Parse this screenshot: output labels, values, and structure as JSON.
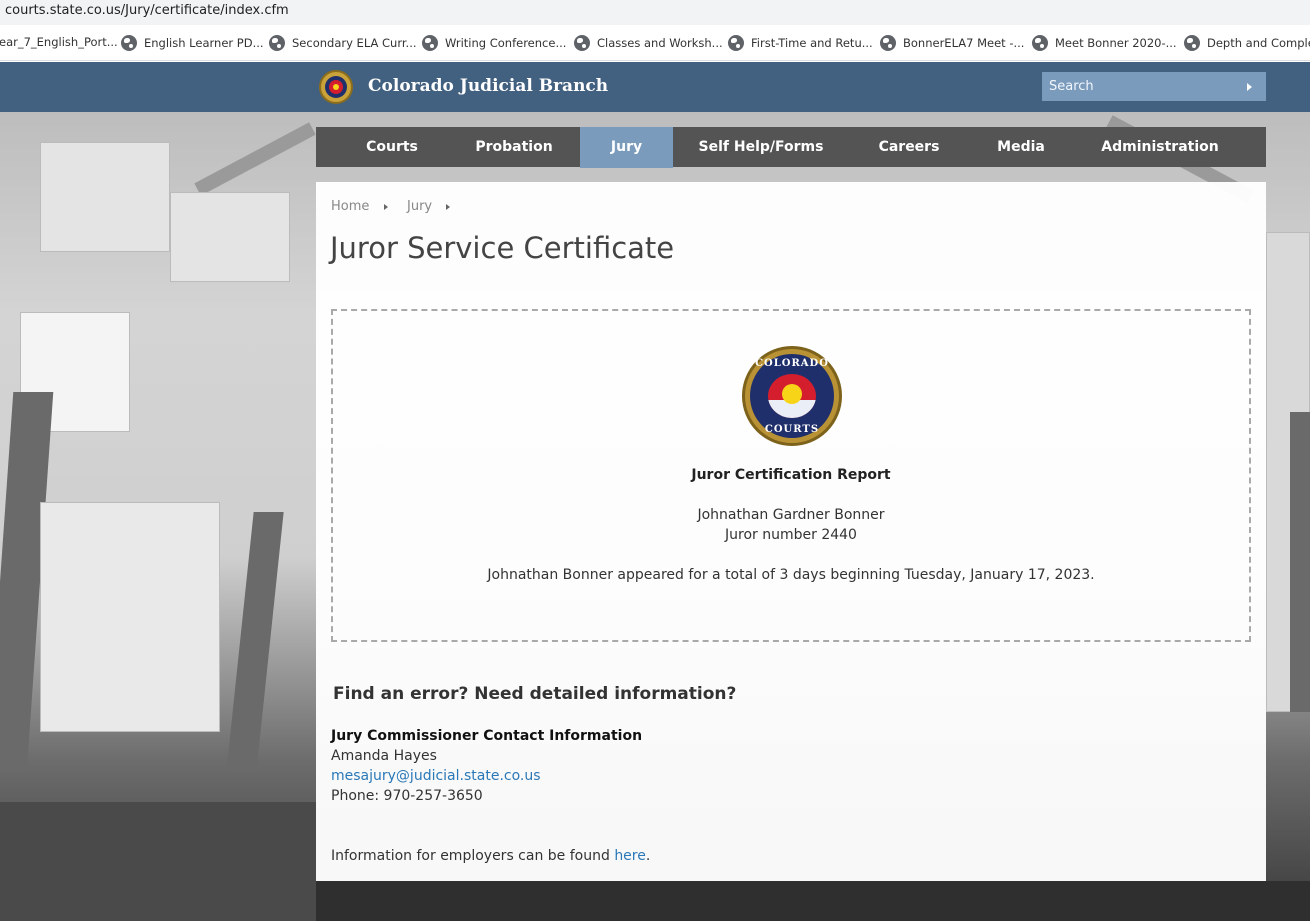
{
  "browser": {
    "url": "courts.state.co.us/Jury/certificate/index.cfm",
    "bookmarks": [
      "ear_7_English_Port...",
      "English Learner PD...",
      "Secondary ELA Curr...",
      "Writing Conference...",
      "Classes and Worksh...",
      "First-Time and Retu...",
      "BonnerELA7 Meet -...",
      "Meet Bonner 2020-...",
      "Depth and Comple..."
    ]
  },
  "header": {
    "site_title": "Colorado Judicial Branch",
    "search_placeholder": "Search"
  },
  "nav": {
    "items": [
      "Courts",
      "Probation",
      "Jury",
      "Self Help/Forms",
      "Careers",
      "Media",
      "Administration"
    ],
    "active": "Jury"
  },
  "breadcrumb": [
    "Home",
    "Jury"
  ],
  "page_title": "Juror Service Certificate",
  "certificate": {
    "seal_top_text": "COLORADO",
    "seal_bottom_text": "COURTS",
    "heading": "Juror Certification Report",
    "juror_name": "Johnathan Gardner Bonner",
    "juror_number": "Juror number 2440",
    "summary": "Johnathan Bonner appeared for a total of 3 days beginning Tuesday, January 17, 2023."
  },
  "help": {
    "heading": "Find an error? Need detailed information?",
    "contact_heading": "Jury Commissioner Contact Information",
    "contact_name": "Amanda Hayes",
    "contact_email": "mesajury@judicial.state.co.us",
    "contact_phone": "Phone: 970-257-3650",
    "employers_text": "Information for employers can be found ",
    "employers_link": "here",
    "employers_end": "."
  },
  "colors": {
    "header_bg": "#42607f",
    "nav_bg": "#545454",
    "nav_active": "#7b9bbd",
    "link": "#2a78b8"
  }
}
